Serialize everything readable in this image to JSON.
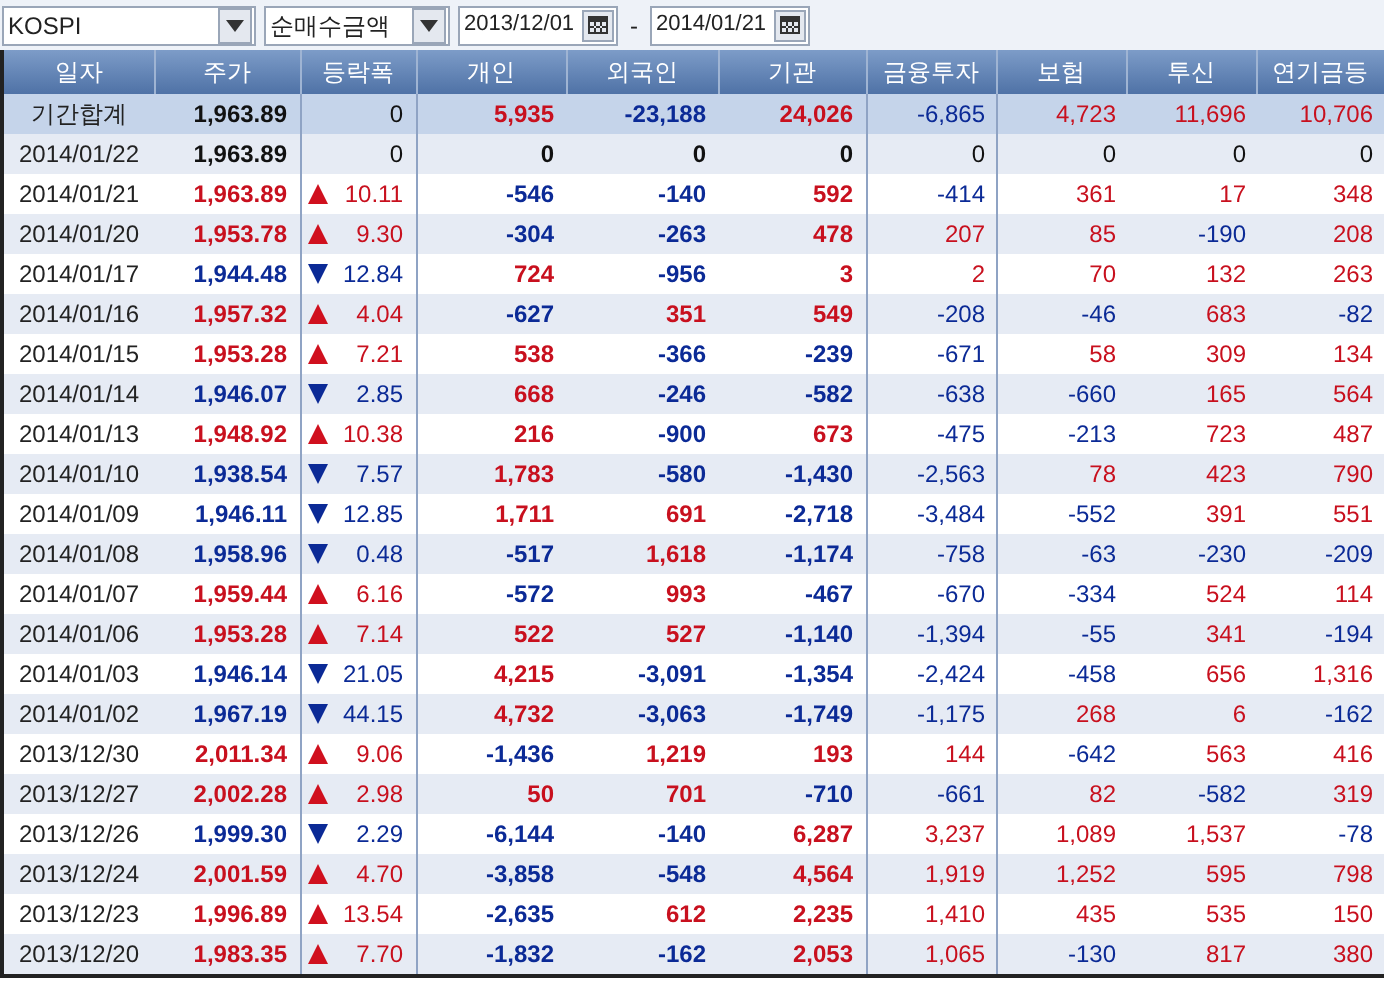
{
  "toolbar": {
    "market": "KOSPI",
    "measure": "순매수금액",
    "start_date": "2013/12/01",
    "separator": "-",
    "end_date": "2014/01/21"
  },
  "table": {
    "columns": [
      "일자",
      "주가",
      "등락폭",
      "개인",
      "외국인",
      "기관",
      "금융투자",
      "보험",
      "투신",
      "연기금등"
    ],
    "rows": [
      {
        "kind": "summary",
        "rising": false,
        "falling": false,
        "cells": [
          "기간합계",
          "1,963.89",
          "0",
          "5,935",
          "-23,188",
          "24,026",
          "-6,865",
          "4,723",
          "11,696",
          "10,706"
        ]
      },
      {
        "kind": "day",
        "rising": false,
        "falling": false,
        "cells": [
          "2014/01/22",
          "1,963.89",
          "0",
          "0",
          "0",
          "0",
          "0",
          "0",
          "0",
          "0"
        ]
      },
      {
        "kind": "day",
        "rising": true,
        "falling": false,
        "cells": [
          "2014/01/21",
          "1,963.89",
          "10.11",
          "-546",
          "-140",
          "592",
          "-414",
          "361",
          "17",
          "348"
        ]
      },
      {
        "kind": "day",
        "rising": true,
        "falling": false,
        "cells": [
          "2014/01/20",
          "1,953.78",
          "9.30",
          "-304",
          "-263",
          "478",
          "207",
          "85",
          "-190",
          "208"
        ]
      },
      {
        "kind": "day",
        "rising": false,
        "falling": true,
        "cells": [
          "2014/01/17",
          "1,944.48",
          "12.84",
          "724",
          "-956",
          "3",
          "2",
          "70",
          "132",
          "263"
        ]
      },
      {
        "kind": "day",
        "rising": true,
        "falling": false,
        "cells": [
          "2014/01/16",
          "1,957.32",
          "4.04",
          "-627",
          "351",
          "549",
          "-208",
          "-46",
          "683",
          "-82"
        ]
      },
      {
        "kind": "day",
        "rising": true,
        "falling": false,
        "cells": [
          "2014/01/15",
          "1,953.28",
          "7.21",
          "538",
          "-366",
          "-239",
          "-671",
          "58",
          "309",
          "134"
        ]
      },
      {
        "kind": "day",
        "rising": false,
        "falling": true,
        "cells": [
          "2014/01/14",
          "1,946.07",
          "2.85",
          "668",
          "-246",
          "-582",
          "-638",
          "-660",
          "165",
          "564"
        ]
      },
      {
        "kind": "day",
        "rising": true,
        "falling": false,
        "cells": [
          "2014/01/13",
          "1,948.92",
          "10.38",
          "216",
          "-900",
          "673",
          "-475",
          "-213",
          "723",
          "487"
        ]
      },
      {
        "kind": "day",
        "rising": false,
        "falling": true,
        "cells": [
          "2014/01/10",
          "1,938.54",
          "7.57",
          "1,783",
          "-580",
          "-1,430",
          "-2,563",
          "78",
          "423",
          "790"
        ]
      },
      {
        "kind": "day",
        "rising": false,
        "falling": true,
        "cells": [
          "2014/01/09",
          "1,946.11",
          "12.85",
          "1,711",
          "691",
          "-2,718",
          "-3,484",
          "-552",
          "391",
          "551"
        ]
      },
      {
        "kind": "day",
        "rising": false,
        "falling": true,
        "cells": [
          "2014/01/08",
          "1,958.96",
          "0.48",
          "-517",
          "1,618",
          "-1,174",
          "-758",
          "-63",
          "-230",
          "-209"
        ]
      },
      {
        "kind": "day",
        "rising": true,
        "falling": false,
        "cells": [
          "2014/01/07",
          "1,959.44",
          "6.16",
          "-572",
          "993",
          "-467",
          "-670",
          "-334",
          "524",
          "114"
        ]
      },
      {
        "kind": "day",
        "rising": true,
        "falling": false,
        "cells": [
          "2014/01/06",
          "1,953.28",
          "7.14",
          "522",
          "527",
          "-1,140",
          "-1,394",
          "-55",
          "341",
          "-194"
        ]
      },
      {
        "kind": "day",
        "rising": false,
        "falling": true,
        "cells": [
          "2014/01/03",
          "1,946.14",
          "21.05",
          "4,215",
          "-3,091",
          "-1,354",
          "-2,424",
          "-458",
          "656",
          "1,316"
        ]
      },
      {
        "kind": "day",
        "rising": false,
        "falling": true,
        "cells": [
          "2014/01/02",
          "1,967.19",
          "44.15",
          "4,732",
          "-3,063",
          "-1,749",
          "-1,175",
          "268",
          "6",
          "-162"
        ]
      },
      {
        "kind": "day",
        "rising": true,
        "falling": false,
        "cells": [
          "2013/12/30",
          "2,011.34",
          "9.06",
          "-1,436",
          "1,219",
          "193",
          "144",
          "-642",
          "563",
          "416"
        ]
      },
      {
        "kind": "day",
        "rising": true,
        "falling": false,
        "cells": [
          "2013/12/27",
          "2,002.28",
          "2.98",
          "50",
          "701",
          "-710",
          "-661",
          "82",
          "-582",
          "319"
        ]
      },
      {
        "kind": "day",
        "rising": false,
        "falling": true,
        "cells": [
          "2013/12/26",
          "1,999.30",
          "2.29",
          "-6,144",
          "-140",
          "6,287",
          "3,237",
          "1,089",
          "1,537",
          "-78"
        ]
      },
      {
        "kind": "day",
        "rising": true,
        "falling": false,
        "cells": [
          "2013/12/24",
          "2,001.59",
          "4.70",
          "-3,858",
          "-548",
          "4,564",
          "1,919",
          "1,252",
          "595",
          "798"
        ]
      },
      {
        "kind": "day",
        "rising": true,
        "falling": false,
        "cells": [
          "2013/12/23",
          "1,996.89",
          "13.54",
          "-2,635",
          "612",
          "2,235",
          "1,410",
          "435",
          "535",
          "150"
        ]
      },
      {
        "kind": "day",
        "rising": true,
        "falling": false,
        "cells": [
          "2013/12/20",
          "1,983.35",
          "7.70",
          "-1,832",
          "-162",
          "2,053",
          "1,065",
          "-130",
          "817",
          "380"
        ]
      }
    ]
  }
}
